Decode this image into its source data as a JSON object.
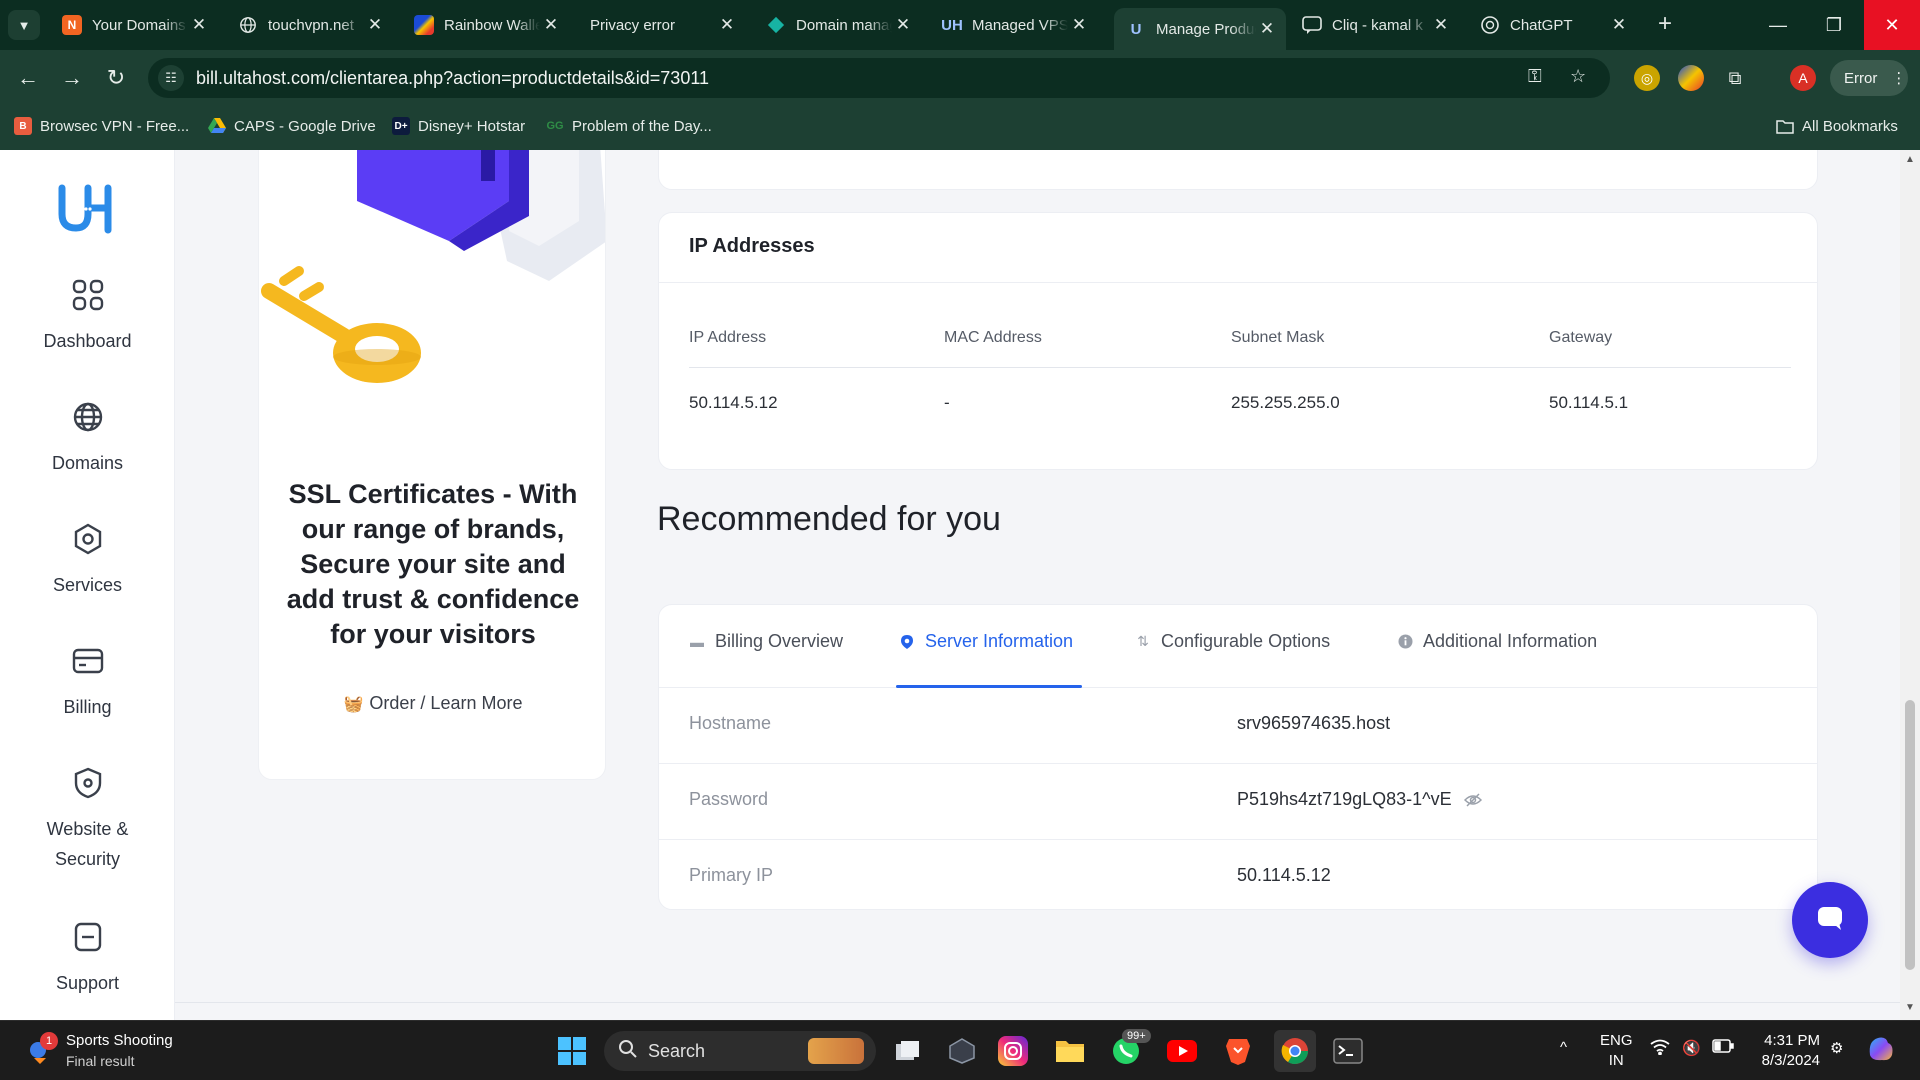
{
  "browser": {
    "tabs": [
      {
        "title": "Your Domains",
        "icon": "ultahost-orange-icon",
        "active": false
      },
      {
        "title": "touchvpn.net",
        "icon": "globe-icon",
        "active": false
      },
      {
        "title": "Rainbow Wallet",
        "icon": "rainbow-icon",
        "active": false
      },
      {
        "title": "Privacy error",
        "icon": "none",
        "active": false
      },
      {
        "title": "Domain manager",
        "icon": "diamond-icon",
        "active": false
      },
      {
        "title": "Managed VPS",
        "icon": "ultahost-icon",
        "active": false
      },
      {
        "title": "Manage Product",
        "icon": "ultahost-icon",
        "active": true
      },
      {
        "title": "Cliq - kamal k",
        "icon": "cliq-icon",
        "active": false
      },
      {
        "title": "ChatGPT",
        "icon": "chatgpt-icon",
        "active": false
      }
    ],
    "url": "bill.ultahost.com/clientarea.php?action=productdetails&id=73011",
    "profile_initial": "A",
    "error_label": "Error",
    "bookmarks": [
      {
        "label": "Browsec VPN - Free...",
        "icon": "browsec-icon"
      },
      {
        "label": "CAPS - Google Drive",
        "icon": "google-drive-icon"
      },
      {
        "label": "Disney+ Hotstar",
        "icon": "hotstar-icon"
      },
      {
        "label": "Problem of the Day...",
        "icon": "gfg-icon"
      }
    ],
    "all_bookmarks": "All Bookmarks"
  },
  "sidebar": {
    "items": [
      {
        "label": "Dashboard",
        "icon": "grid-icon"
      },
      {
        "label": "Domains",
        "icon": "globe-icon"
      },
      {
        "label": "Services",
        "icon": "hexagon-icon"
      },
      {
        "label": "Billing",
        "icon": "card-icon"
      },
      {
        "label": "Website &",
        "label2": "Security",
        "icon": "shield-icon"
      },
      {
        "label": "Support",
        "icon": "support-icon"
      }
    ]
  },
  "promo": {
    "title": "SSL Certificates - With our range of brands, Secure your site and add trust & confidence for your visitors",
    "link": "Order / Learn More"
  },
  "ip_addresses": {
    "title": "IP Addresses",
    "columns": [
      "IP Address",
      "MAC Address",
      "Subnet Mask",
      "Gateway"
    ],
    "rows": [
      [
        "50.114.5.12",
        "-",
        "255.255.255.0",
        "50.114.5.1"
      ]
    ]
  },
  "recommended_title": "Recommended for you",
  "info_tabs": [
    {
      "label": "Billing Overview",
      "icon": "billing-icon",
      "active": false
    },
    {
      "label": "Server Information",
      "icon": "location-pin-icon",
      "active": true
    },
    {
      "label": "Configurable Options",
      "icon": "sliders-icon",
      "active": false
    },
    {
      "label": "Additional Information",
      "icon": "info-icon",
      "active": false
    }
  ],
  "server_info": [
    {
      "key": "Hostname",
      "value": "srv965974635.host"
    },
    {
      "key": "Password",
      "value": "P519hs4zt719gLQ83-1^vE"
    },
    {
      "key": "Primary IP",
      "value": "50.114.5.12"
    }
  ],
  "taskbar": {
    "weather_title": "Sports Shooting",
    "weather_sub": "Final result",
    "weather_badge": "1",
    "search_placeholder": "Search",
    "whatsapp_badge": "99+",
    "lang_1": "ENG",
    "lang_2": "IN",
    "time": "4:31 PM",
    "date": "8/3/2024"
  },
  "colors": {
    "accent": "#2563eb",
    "chat_button": "#3b2ee0",
    "browser_dark": "#0c2d21",
    "browser_toolbar": "#1d4033"
  }
}
